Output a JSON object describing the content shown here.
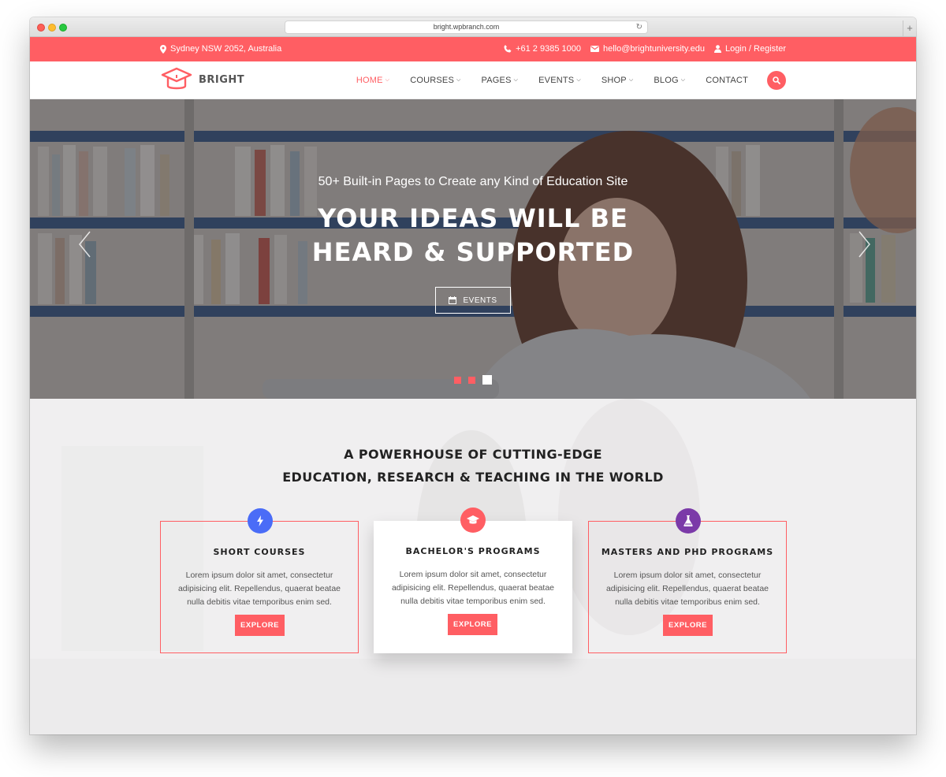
{
  "browser": {
    "url": "bright.wpbranch.com"
  },
  "topbar": {
    "location": "Sydney NSW 2052, Australia",
    "phone": "+61 2 9385 1000",
    "email": "hello@brightuniversity.edu",
    "login": "Login / Register"
  },
  "header": {
    "logo_text": "BRIGHT",
    "nav": [
      {
        "label": "HOME",
        "active": true
      },
      {
        "label": "COURSES"
      },
      {
        "label": "PAGES"
      },
      {
        "label": "EVENTS"
      },
      {
        "label": "SHOP"
      },
      {
        "label": "BLOG"
      },
      {
        "label": "CONTACT"
      }
    ]
  },
  "hero": {
    "subtitle": "50+ Built-in Pages to Create any Kind of Education Site",
    "title_line1": "YOUR IDEAS WILL BE",
    "title_line2": "HEARD & SUPPORTED",
    "button_label": "EVENTS"
  },
  "section": {
    "title_line1": "A POWERHOUSE OF CUTTING-EDGE",
    "title_line2": "EDUCATION, RESEARCH & TEACHING IN THE WORLD",
    "cards": [
      {
        "title": "SHORT COURSES",
        "text": "Lorem ipsum dolor sit amet, consectetur adipisicing elit. Repellendus, quaerat beatae nulla debitis vitae temporibus enim sed.",
        "button": "EXPLORE",
        "icon": "lightning-icon",
        "color": "#4a6cf7"
      },
      {
        "title": "BACHELOR'S PROGRAMS",
        "text": "Lorem ipsum dolor sit amet, consectetur adipisicing elit. Repellendus, quaerat beatae nulla debitis vitae temporibus enim sed.",
        "button": "EXPLORE",
        "icon": "graduation-cap-icon",
        "color": "#ff5e63"
      },
      {
        "title": "MASTERS AND PHD PROGRAMS",
        "text": "Lorem ipsum dolor sit amet, consectetur adipisicing elit. Repellendus, quaerat beatae nulla debitis vitae temporibus enim sed.",
        "button": "EXPLORE",
        "icon": "flask-icon",
        "color": "#7b3aa8"
      }
    ]
  },
  "colors": {
    "accent": "#ff5e63"
  }
}
